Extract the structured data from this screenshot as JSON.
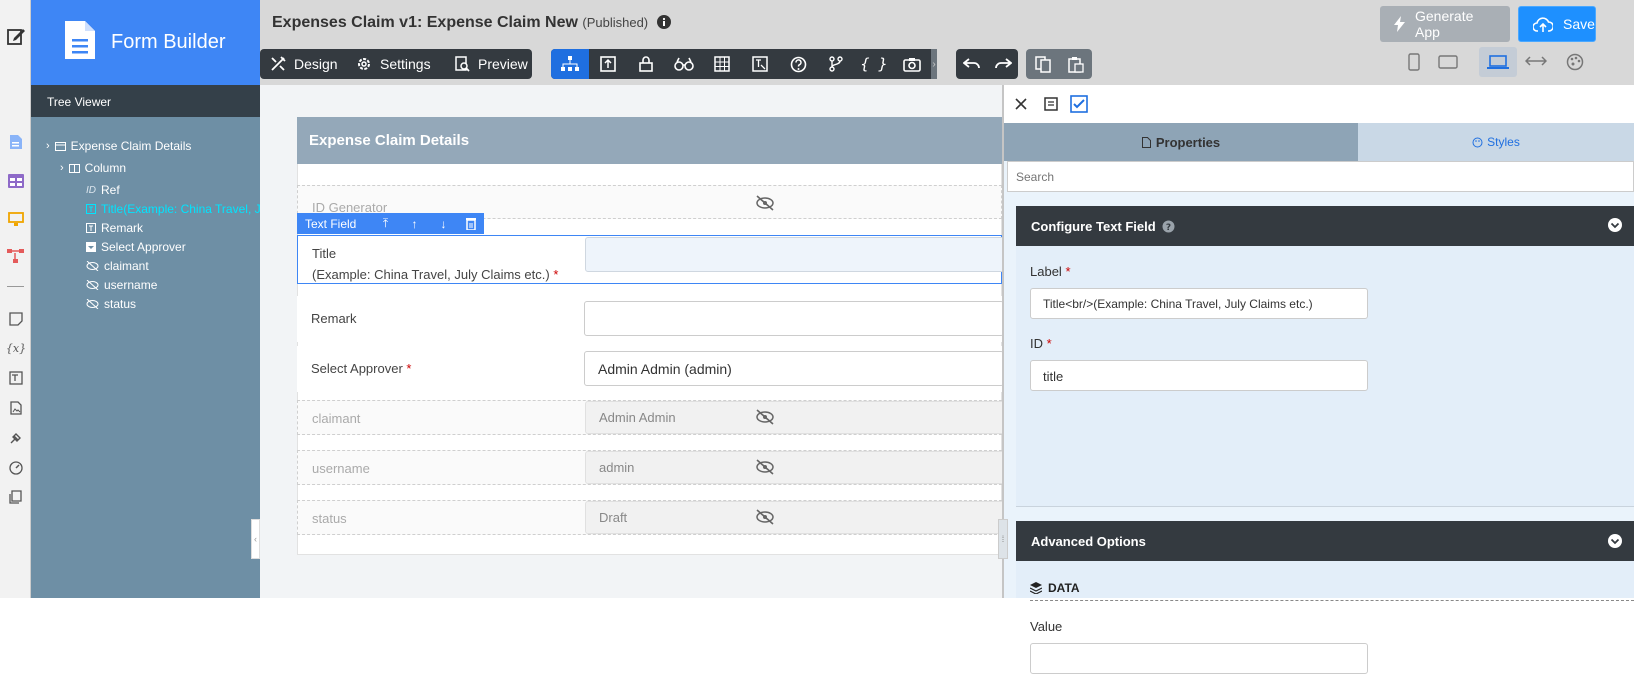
{
  "app": {
    "brand": "Form Builder",
    "title": "Expenses Claim v1: Expense Claim New",
    "status": "(Published)"
  },
  "tree": {
    "header": "Tree Viewer",
    "items": [
      {
        "label": "Expense Claim Details"
      },
      {
        "label": "Column"
      },
      {
        "label": "Ref",
        "prefix": "ID"
      },
      {
        "label": "Title(Example: China Travel, July Claims etc.)"
      },
      {
        "label": "Remark"
      },
      {
        "label": "Select Approver"
      },
      {
        "label": "claimant"
      },
      {
        "label": "username"
      },
      {
        "label": "status"
      }
    ]
  },
  "toolbar": {
    "design": "Design",
    "settings": "Settings",
    "preview": "Preview",
    "generate_app": "Generate App",
    "save": "Save"
  },
  "form": {
    "section_title": "Expense Claim Details",
    "field_toolbar_label": "Text Field",
    "fields": [
      {
        "label": "ID Generator"
      },
      {
        "label": "Title",
        "sublabel": "(Example: China Travel, July Claims etc.)",
        "required": "*",
        "value": ""
      },
      {
        "label": "Remark",
        "value": ""
      },
      {
        "label": "Select Approver",
        "required": "*",
        "value": "Admin Admin (admin)"
      },
      {
        "label": "claimant",
        "value": "Admin Admin"
      },
      {
        "label": "username",
        "value": "admin"
      },
      {
        "label": "status",
        "value": "Draft"
      }
    ]
  },
  "panel": {
    "tabs": {
      "properties": "Properties",
      "styles": "Styles"
    },
    "search_placeholder": "Search",
    "configure_title": "Configure Text Field",
    "label_label": "Label",
    "label_value": "Title<br/>(Example: China Travel, July Claims etc.)",
    "id_label": "ID",
    "id_value": "title",
    "required_mark": "*",
    "advanced_title": "Advanced Options",
    "data_title": "DATA",
    "value_label": "Value",
    "value_value": ""
  },
  "colors": {
    "brand": "#3e86f5",
    "save": "#1e90ff",
    "tree_bg": "#6e8fa5",
    "selected_tree": "#00e5ff",
    "section_header": "#94a8b9",
    "panel_header": "#343a40"
  }
}
